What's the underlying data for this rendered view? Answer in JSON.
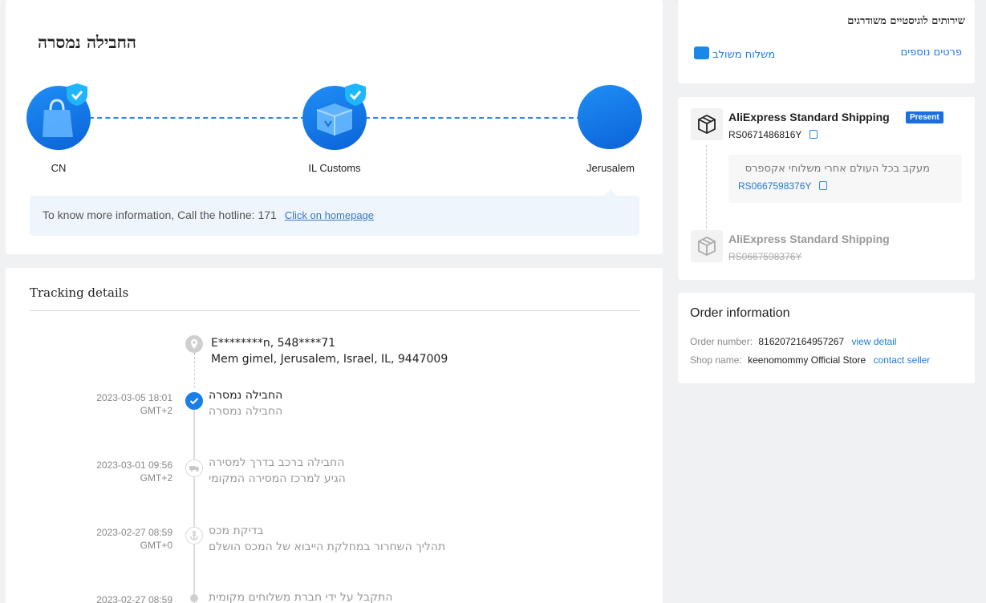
{
  "status": {
    "title": "החבילה נמסרה",
    "nodes": [
      {
        "label": "CN",
        "icon": "shopping-bag-icon"
      },
      {
        "label": "IL Customs",
        "icon": "customs-box-icon"
      },
      {
        "label": "Jerusalem",
        "icon": "destination-icon"
      }
    ],
    "info_text": "To know more information, Call the hotline: 171",
    "info_link": "Click on homepage"
  },
  "tracking": {
    "title": "Tracking details",
    "address_line1": "E********n,  548****71",
    "address_line2": "Mem gimel,  Jerusalem,  Israel,  IL,  9447009",
    "events": [
      {
        "date": "2023-03-05 18:01",
        "tz": "GMT+2",
        "title": "החבילה נמסרה",
        "desc": "החבילה נמסרה",
        "active": true
      },
      {
        "date": "2023-03-01 09:56",
        "tz": "GMT+2",
        "title": "החבילה ברכב בדרך למסירה",
        "desc": "הגיע למרכז המסירה המקומי",
        "active": false
      },
      {
        "date": "2023-02-27 08:59",
        "tz": "GMT+0",
        "title": "בדיקת מכס",
        "desc": "תהליך השחרור במחלקת הייבוא של המכס הושלם",
        "active": false
      },
      {
        "date": "2023-02-27 08:59",
        "tz": "",
        "title": "התקבל על ידי חברת משלוחים מקומית",
        "desc": "",
        "active": false
      }
    ]
  },
  "services": {
    "title": "שירותים לוגיסטיים משודרגים",
    "combined_shipping": "משלוח משולב",
    "more_details": "פרטים נוספים"
  },
  "shipping": {
    "current": {
      "name": "AliExpress Standard Shipping",
      "badge": "Present",
      "number": "RS0671486816Y"
    },
    "sub_text": "מעקב בכל העולם אחרי משלוחי אקספרס",
    "sub_number": "RS0667598376Y",
    "previous": {
      "name": "AliExpress Standard Shipping",
      "number": "RS0667598376Y"
    }
  },
  "order": {
    "title": "Order information",
    "number_label": "Order number:",
    "number": "8162072164957267",
    "view_detail": "view detail",
    "shop_label": "Shop name:",
    "shop": "keenomommy Official Store",
    "contact": "contact seller"
  },
  "colors": {
    "accent": "#1a7fe8",
    "background": "#f0f1f3"
  }
}
